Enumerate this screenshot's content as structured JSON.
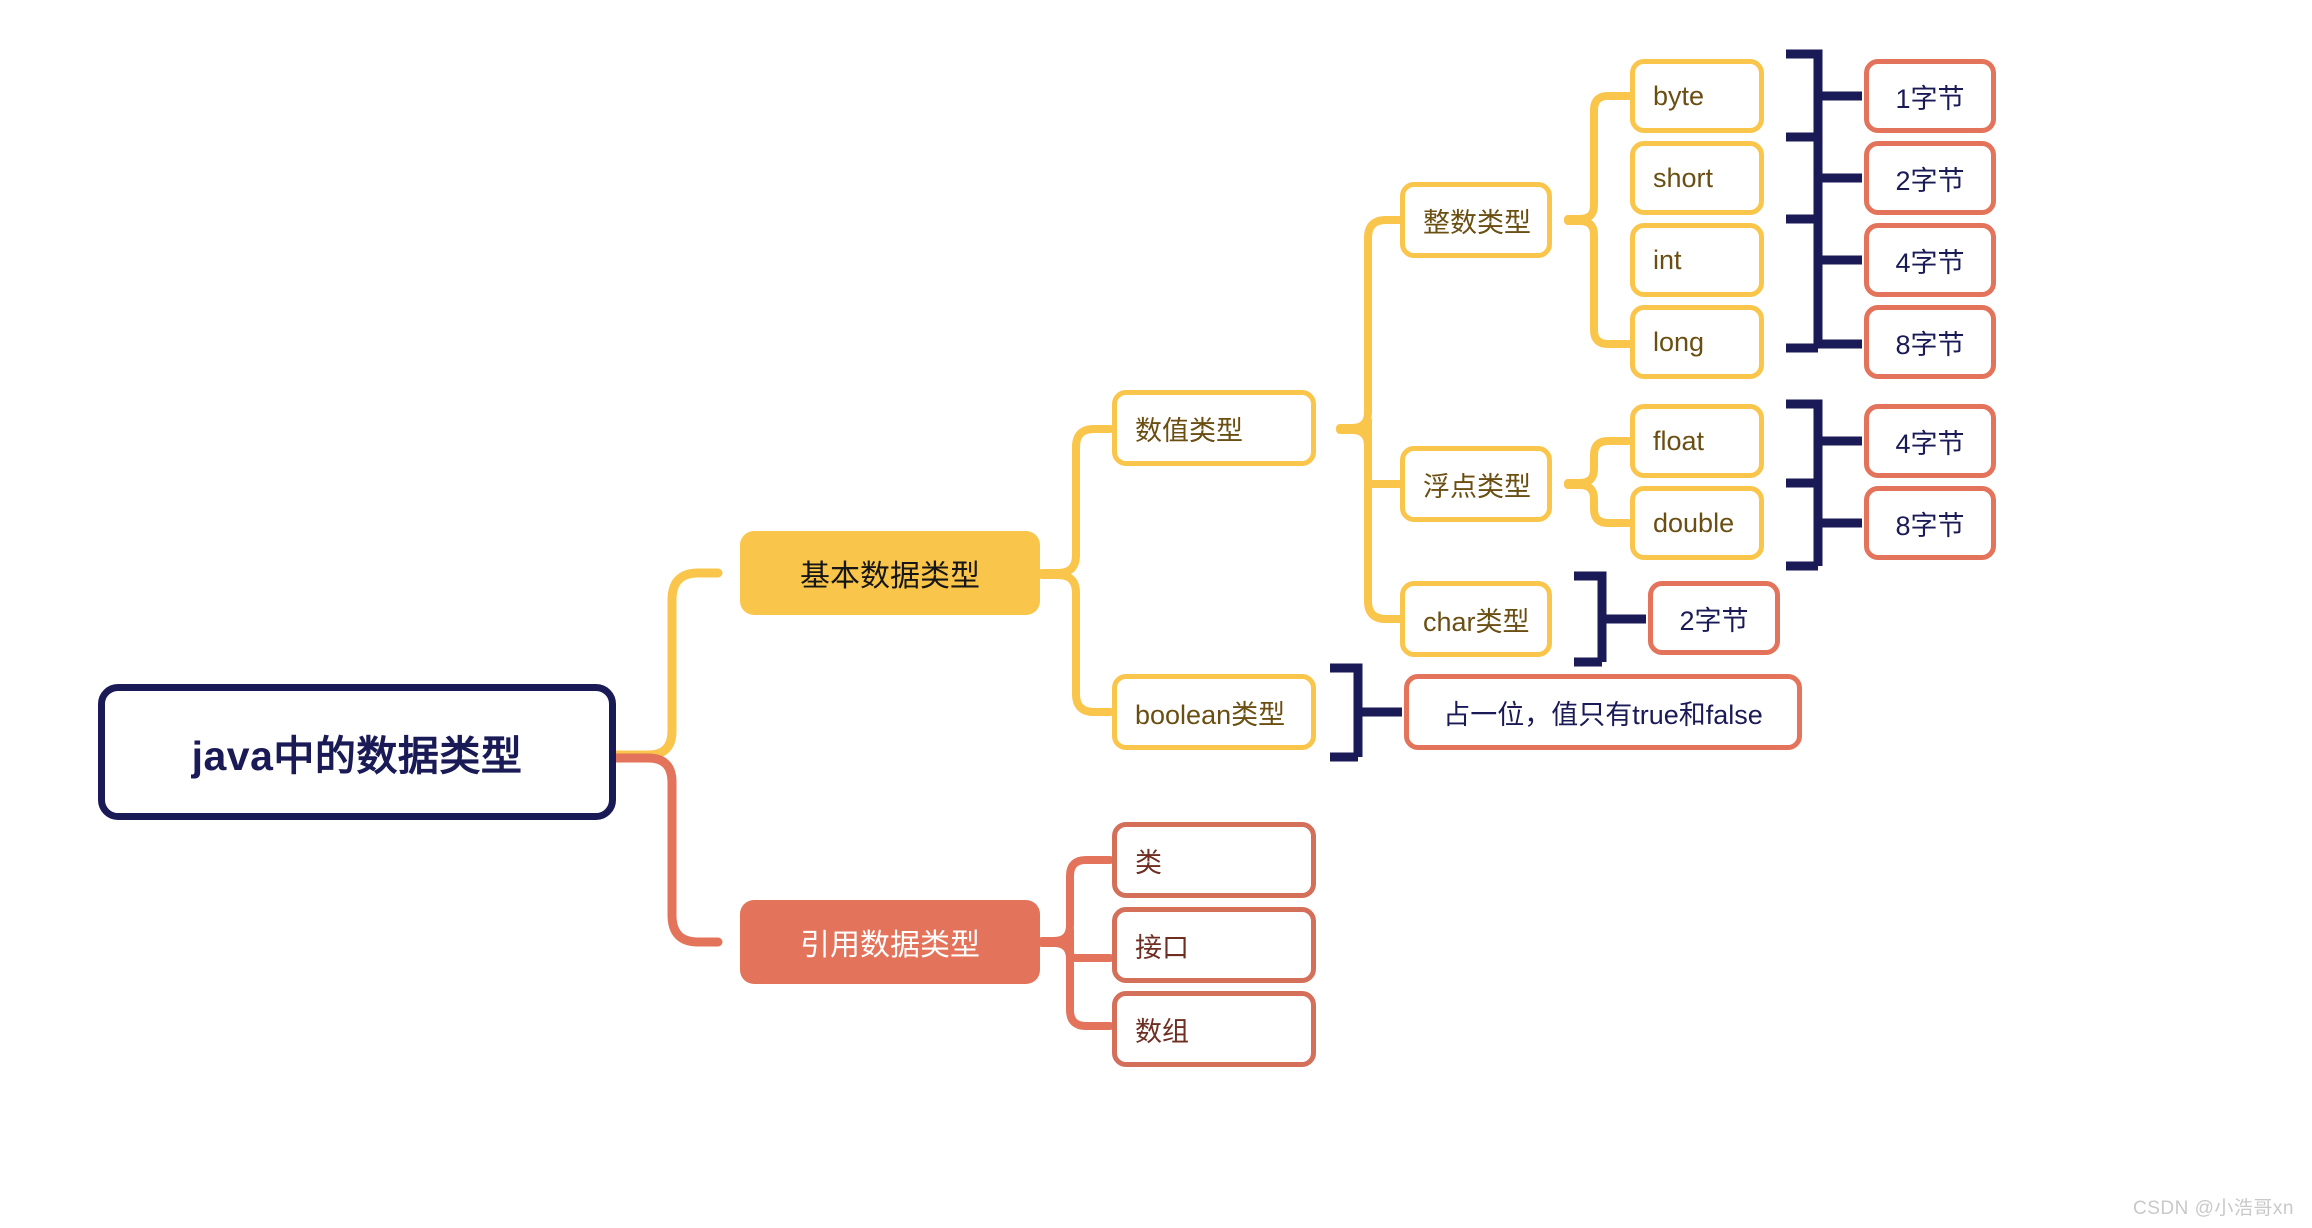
{
  "diagram": {
    "title": "java中的数据类型",
    "type": "mindmap",
    "colors": {
      "navy": "#1a1a56",
      "yellow": "#fac54b",
      "coral": "#e3735a",
      "yellow_text": "#6b4f12",
      "coral_text": "#6e2f22",
      "background": "#ffffff"
    }
  },
  "root": {
    "label": "java中的数据类型"
  },
  "level2": [
    {
      "id": "primitive",
      "label": "基本数据类型"
    },
    {
      "id": "reference",
      "label": "引用数据类型"
    }
  ],
  "level3": [
    {
      "id": "numeric",
      "label": "数值类型"
    },
    {
      "id": "boolean",
      "label": "boolean类型"
    },
    {
      "id": "class",
      "label": "类"
    },
    {
      "id": "interface",
      "label": "接口"
    },
    {
      "id": "array",
      "label": "数组"
    }
  ],
  "level4": [
    {
      "id": "integer",
      "label": "整数类型"
    },
    {
      "id": "floatpoint",
      "label": "浮点类型"
    },
    {
      "id": "chartype",
      "label": "char类型"
    }
  ],
  "level5": [
    {
      "id": "byte",
      "label": "byte"
    },
    {
      "id": "short",
      "label": "short"
    },
    {
      "id": "int",
      "label": "int"
    },
    {
      "id": "long",
      "label": "long"
    },
    {
      "id": "float",
      "label": "float"
    },
    {
      "id": "double",
      "label": "double"
    }
  ],
  "level6": [
    {
      "id": "byte-size",
      "label": "1字节"
    },
    {
      "id": "short-size",
      "label": "2字节"
    },
    {
      "id": "int-size",
      "label": "4字节"
    },
    {
      "id": "long-size",
      "label": "8字节"
    },
    {
      "id": "float-size",
      "label": "4字节"
    },
    {
      "id": "double-size",
      "label": "8字节"
    },
    {
      "id": "char-size",
      "label": "2字节"
    },
    {
      "id": "boolean-desc",
      "label": "占一位，值只有true和false"
    }
  ],
  "watermark": {
    "text": "CSDN @小浩哥xn"
  }
}
